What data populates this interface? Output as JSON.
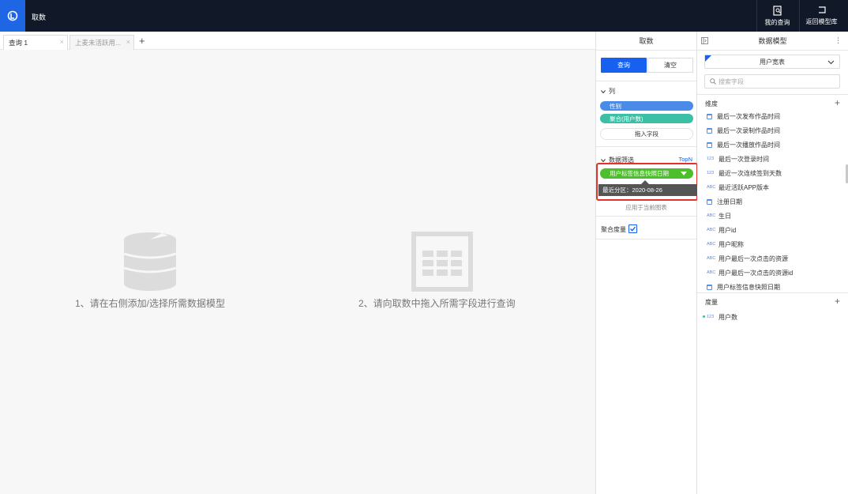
{
  "app": {
    "title": "取数"
  },
  "top_actions": {
    "my_queries": "我的查询",
    "back_to_models": "返回模型库"
  },
  "tabs": [
    {
      "label": "查询 1",
      "active": true
    },
    {
      "label": "上麦未活跃用...",
      "active": false
    }
  ],
  "workspace": {
    "hint_1": "1、请在右侧添加/选择所需数据模型",
    "hint_2": "2、请向取数中拖入所需字段进行查询"
  },
  "middle_panel": {
    "title": "取数",
    "query_button": "查询",
    "clear_button": "清空",
    "columns_title": "列",
    "columns": [
      "性别",
      "聚合(用户数)"
    ],
    "drop_zone": "拖入字段",
    "filter_title": "数据筛选",
    "topn": "TopN",
    "filter_pill": "用户标签信息快照日期",
    "tooltip": "最近分区：2020-08-26",
    "apply_text": "应用于当前图表",
    "aggregate_label": "聚合度量",
    "aggregate_checked": true
  },
  "right_panel": {
    "title": "数据模型",
    "model_name": "用户宽表",
    "search_placeholder": "搜索字段",
    "dimensions_title": "维度",
    "dimensions": [
      {
        "type": "date",
        "label": "最后一次发布作品时间"
      },
      {
        "type": "date",
        "label": "最后一次录制作品时间"
      },
      {
        "type": "date",
        "label": "最后一次播放作品时间"
      },
      {
        "type": "123",
        "label": "最后一次登录时间"
      },
      {
        "type": "123",
        "label": "最近一次连续签到天数"
      },
      {
        "type": "ABC",
        "label": "最近活跃APP版本"
      },
      {
        "type": "date",
        "label": "注册日期"
      },
      {
        "type": "ABC",
        "label": "生日"
      },
      {
        "type": "ABC",
        "label": "用户id"
      },
      {
        "type": "ABC",
        "label": "用户昵称"
      },
      {
        "type": "ABC",
        "label": "用户最后一次点击的资源"
      },
      {
        "type": "ABC",
        "label": "用户最后一次点击的资源id"
      },
      {
        "type": "date",
        "label": "用户标签信息快照日期"
      }
    ],
    "measures_title": "度量",
    "measures": [
      {
        "type": "123",
        "label": "用户数"
      }
    ]
  }
}
